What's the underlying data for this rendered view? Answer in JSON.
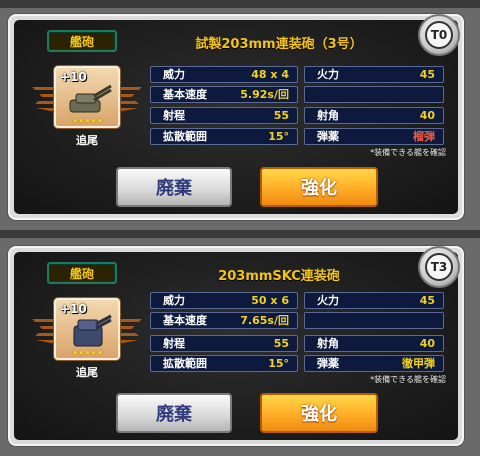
{
  "cards": [
    {
      "type_label": "艦砲",
      "name": "試製203mm連装砲（3号）",
      "tier": "T0",
      "plus_level": "+10",
      "stars": "★★★★★",
      "tag": "追尾",
      "stats": {
        "power": {
          "label": "威力",
          "value": "48 x 4"
        },
        "base_speed": {
          "label": "基本速度",
          "value": "5.92s/回"
        },
        "range": {
          "label": "射程",
          "value": "55"
        },
        "spread": {
          "label": "拡散範囲",
          "value": "15°"
        },
        "firepower": {
          "label": "火力",
          "value": "45"
        },
        "angle": {
          "label": "射角",
          "value": "40"
        },
        "ammo": {
          "label": "弾薬",
          "value": "榴弾"
        }
      },
      "note": "*装備できる艦を確認",
      "scrap_label": "廃棄",
      "modernize_label": "強化"
    },
    {
      "type_label": "艦砲",
      "name": "203mmSKC連装砲",
      "tier": "T3",
      "plus_level": "+10",
      "stars": "★★★★★",
      "tag": "追尾",
      "stats": {
        "power": {
          "label": "威力",
          "value": "50 x 6"
        },
        "base_speed": {
          "label": "基本速度",
          "value": "7.65s/回"
        },
        "range": {
          "label": "射程",
          "value": "55"
        },
        "spread": {
          "label": "拡散範囲",
          "value": "15°"
        },
        "firepower": {
          "label": "火力",
          "value": "45"
        },
        "angle": {
          "label": "射角",
          "value": "40"
        },
        "ammo": {
          "label": "弾薬",
          "value": "徹甲弾"
        }
      },
      "note": "*装備できる艦を確認",
      "scrap_label": "廃棄",
      "modernize_label": "強化"
    }
  ],
  "colors": {
    "accent_yellow": "#f4d21a",
    "stat_box": "#0d1a3e",
    "ammo_red": "#f05a3c",
    "button_orange": "#ffb02a"
  },
  "icons": {
    "tier_badge": "anchor-badge-icon",
    "wings": "wing-ornament-icon",
    "equip": "naval-gun-icon"
  }
}
